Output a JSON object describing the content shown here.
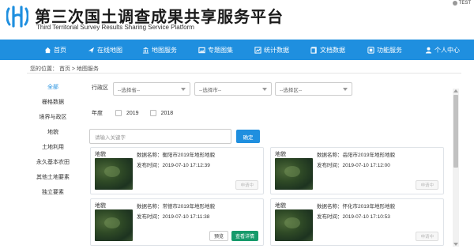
{
  "header": {
    "title": "第三次国土调查成果共享服务平台",
    "subtitle": "Third Territorial Survey Results Sharing Service Platform",
    "user": "TEST"
  },
  "nav": [
    {
      "label": "首页",
      "icon": "home-icon"
    },
    {
      "label": "在线地图",
      "icon": "plane-icon"
    },
    {
      "label": "地图服务",
      "icon": "building-icon"
    },
    {
      "label": "专题图集",
      "icon": "album-icon"
    },
    {
      "label": "统计数据",
      "icon": "chart-icon"
    },
    {
      "label": "文档数据",
      "icon": "document-icon"
    },
    {
      "label": "功能服务",
      "icon": "tools-icon"
    },
    {
      "label": "个人中心",
      "icon": "person-icon"
    }
  ],
  "breadcrumb": "您的位置： 首页 > 地图服务",
  "sidebar": {
    "items": [
      {
        "label": "全部",
        "active": true
      },
      {
        "label": "栅格数据",
        "active": false
      },
      {
        "label": "境界与政区",
        "active": false
      },
      {
        "label": "地貌",
        "active": false
      },
      {
        "label": "土地利用",
        "active": false
      },
      {
        "label": "永久基本农田",
        "active": false
      },
      {
        "label": "其他土地要素",
        "active": false
      },
      {
        "label": "独立要素",
        "active": false
      }
    ]
  },
  "filters": {
    "region_label": "行政区",
    "province_placeholder": "--选择省--",
    "city_placeholder": "--选择市--",
    "district_placeholder": "--选择区--",
    "year_label": "年度",
    "years": [
      "2019",
      "2018"
    ],
    "search_placeholder": "请输入关键字",
    "confirm_label": "确定"
  },
  "cards": [
    {
      "type": "地貌",
      "name": "数据名称：衡阳市2019年地形地貌",
      "time": "发布时间：2019-07-10 17:12:39",
      "actions": [
        "申请中"
      ]
    },
    {
      "type": "地貌",
      "name": "数据名称：岳阳市2019年地形地貌",
      "time": "发布时间：2019-07-10 17:12:00",
      "actions": [
        "申请中"
      ]
    },
    {
      "type": "地貌",
      "name": "数据名称：常德市2019年地形地貌",
      "time": "发布时间：2019-07-10 17:11:38",
      "actions": [
        "预览",
        "查看详情"
      ]
    },
    {
      "type": "地貌",
      "name": "数据名称：怀化市2019年地形地貌",
      "time": "发布时间：2019-07-10 17:10:53",
      "actions": [
        "申请中"
      ]
    }
  ],
  "colors": {
    "nav_bg": "#1f8fdf",
    "primary": "#1f8fdf",
    "detail_button": "#169a6b"
  }
}
